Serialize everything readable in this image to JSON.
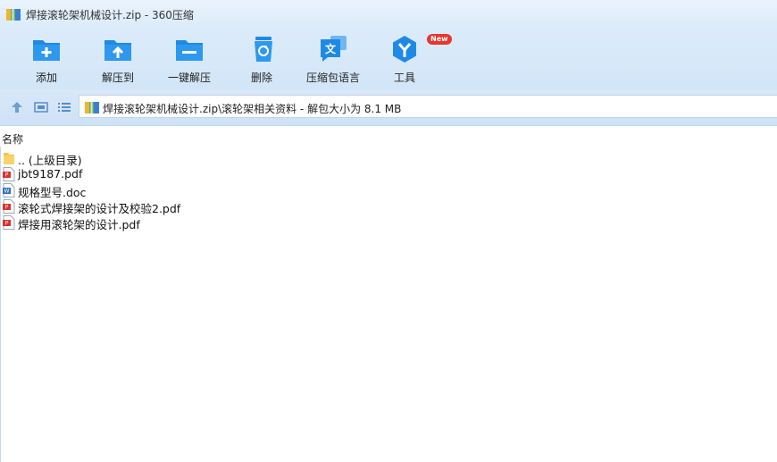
{
  "window": {
    "title": "焊接滚轮架机械设计.zip - 360压缩"
  },
  "toolbar": {
    "items": [
      {
        "label": "添加"
      },
      {
        "label": "解压到"
      },
      {
        "label": "一键解压"
      },
      {
        "label": "删除"
      },
      {
        "label": "压缩包语言"
      },
      {
        "label": "工具",
        "badge": "New"
      }
    ]
  },
  "address": {
    "path": "焊接滚轮架机械设计.zip\\滚轮架相关资料 - 解包大小为 8.1 MB"
  },
  "list": {
    "column_name": "名称",
    "rows": [
      {
        "name": ".. (上级目录)",
        "type": "folder"
      },
      {
        "name": "jbt9187.pdf",
        "type": "pdf"
      },
      {
        "name": "规格型号.doc",
        "type": "doc"
      },
      {
        "name": "滚轮式焊接架的设计及校验2.pdf",
        "type": "pdf"
      },
      {
        "name": "焊接用滚轮架的设计.pdf",
        "type": "pdf"
      }
    ]
  },
  "colors": {
    "accent": "#1e88e5",
    "pdf": "#d9322b",
    "doc": "#2f6fc1",
    "folder": "#f4c84a"
  }
}
